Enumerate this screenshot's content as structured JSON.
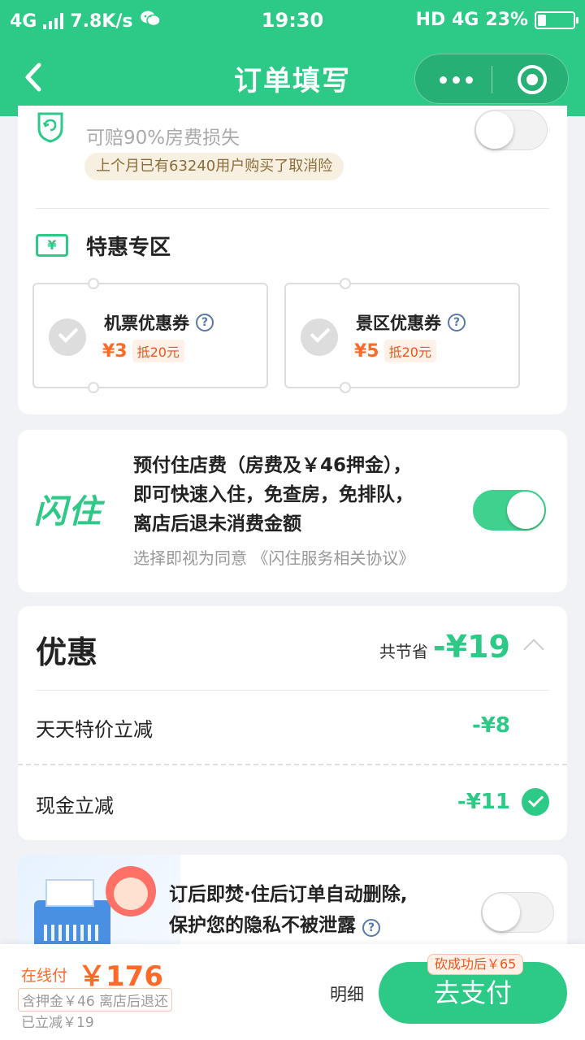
{
  "status_bar": {
    "network": "4G",
    "speed": "7.8K/s",
    "time": "19:30",
    "right_network": "HD 4G",
    "battery": "23%",
    "battery_level": 0.23
  },
  "header": {
    "title": "订单填写"
  },
  "insurance": {
    "description": "可赔90%房费损失",
    "tag": "上个月已有63240用户购买了取消险",
    "enabled": false
  },
  "promo": {
    "title": "特惠专区",
    "icon_text": "¥",
    "coupons": [
      {
        "name": "机票优惠券",
        "amount": "¥3",
        "badge": "抵20元"
      },
      {
        "name": "景区优惠券",
        "amount": "¥5",
        "badge": "抵20元"
      }
    ]
  },
  "flash_stay": {
    "logo": "闪住",
    "text_lines": [
      "预付住店费（房费及￥46押金），",
      "即可快速入住，免查房，免排队，",
      "离店后退未消费金额"
    ],
    "agreement": "选择即视为同意 《闪住服务相关协议》",
    "enabled": true
  },
  "discounts": {
    "title": "优惠",
    "total_label": "共节省",
    "total_amount": "-¥19",
    "rows": [
      {
        "label": "天天特价立减",
        "amount": "-¥8"
      },
      {
        "label": "现金立减",
        "amount": "-¥11"
      }
    ]
  },
  "privacy": {
    "line1": "订后即焚·住后订单自动删除,",
    "line2": "保护您的隐私不被泄露",
    "enabled": false
  },
  "bottom_bar": {
    "pay_label": "在线付",
    "pay_amount": "￥176",
    "deposit_note": "含押金￥46 离店后退还",
    "reduced_note": "已立减￥19",
    "detail_label": "明细",
    "pay_button": "去支付",
    "pay_badge": "砍成功后￥65"
  },
  "colors": {
    "brand": "#2dc987",
    "price": "#ff6a28"
  }
}
